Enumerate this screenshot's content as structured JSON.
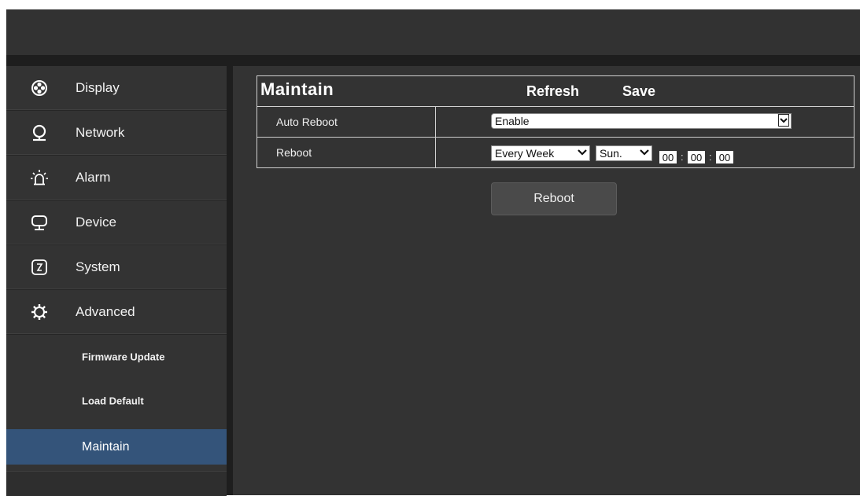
{
  "colors": {
    "background": "#1e1e1e",
    "sidebar": "#333333",
    "active_item": "#34547a",
    "text": "#ffffff"
  },
  "sidebar": {
    "items": [
      {
        "label": "Display",
        "icon": "display-icon"
      },
      {
        "label": "Network",
        "icon": "network-icon"
      },
      {
        "label": "Alarm",
        "icon": "alarm-icon"
      },
      {
        "label": "Device",
        "icon": "device-icon"
      },
      {
        "label": "System",
        "icon": "system-icon"
      },
      {
        "label": "Advanced",
        "icon": "advanced-icon"
      }
    ],
    "subitems": [
      {
        "label": "Firmware Update",
        "active": false
      },
      {
        "label": "Load Default",
        "active": false
      },
      {
        "label": "Maintain",
        "active": true
      }
    ]
  },
  "panel": {
    "title": "Maintain",
    "refresh_label": "Refresh",
    "save_label": "Save",
    "rows": {
      "auto_reboot": {
        "label": "Auto Reboot",
        "value": "Enable"
      },
      "reboot": {
        "label": "Reboot",
        "frequency": "Every Week",
        "day": "Sun.",
        "hour": "00",
        "minute": "00",
        "second": "00"
      }
    }
  },
  "reboot_button": "Reboot"
}
